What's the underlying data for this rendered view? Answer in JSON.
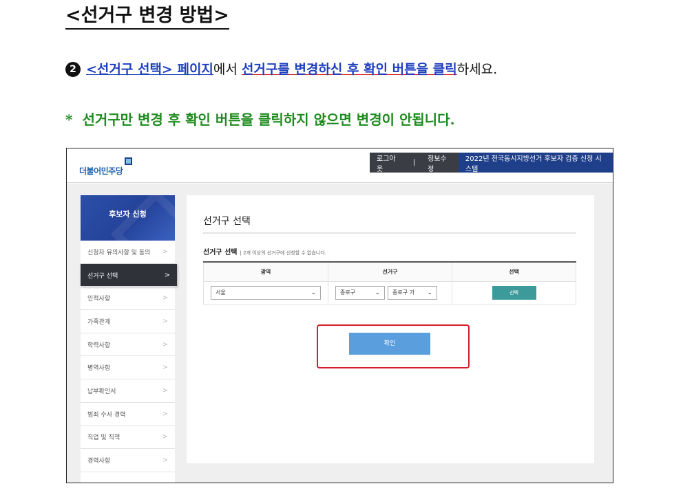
{
  "document": {
    "title": "<선거구 변경 방법>",
    "step_number": "2",
    "instruction_link1": "<선거구 선택> 페이지",
    "instruction_mid": "에서 ",
    "instruction_link2": "선거구를 변경하신 후 확인 버튼을 클릭",
    "instruction_end": "하세요.",
    "note_star": "*",
    "note": "선거구만 변경 후 확인 버튼을 클릭하지 않으면 변경이 안됩니다."
  },
  "header": {
    "logo": "더불어민주당",
    "logout": "로그아웃",
    "separator": "|",
    "edit_info": "정보수정",
    "system_name": "2022년 전국동시지방선거 후보자 검증 신청 시스템"
  },
  "sidebar": {
    "hero_title": "후보자 신청",
    "items": [
      {
        "label": "신청자 유의사항 및 동의"
      },
      {
        "label": "선거구 선택"
      },
      {
        "label": "인적사항"
      },
      {
        "label": "가족관계"
      },
      {
        "label": "학력사항"
      },
      {
        "label": "병역사항"
      },
      {
        "label": "납부확인서"
      },
      {
        "label": "범죄 수사 경력"
      },
      {
        "label": "직업 및 직책"
      },
      {
        "label": "경력사항"
      }
    ],
    "active_index": 1,
    "chevron": ">"
  },
  "main": {
    "page_title": "선거구 선택",
    "section_title": "선거구 선택",
    "section_note": "| 2개 이상의 선거구에 신청할 수 없습니다.",
    "table": {
      "headers": [
        "광역",
        "선거구",
        "선택"
      ],
      "region_value": "서울",
      "district_value": "종로구",
      "district_sub_value": "종로구 가",
      "select_button": "선택"
    },
    "confirm_button": "확인"
  },
  "colors": {
    "accent_blue": "#1f3f8a",
    "confirm_blue": "#5b9ede",
    "teal": "#3d9a9a",
    "highlight_red": "#d21d2a",
    "note_green": "#1d8a1d"
  }
}
